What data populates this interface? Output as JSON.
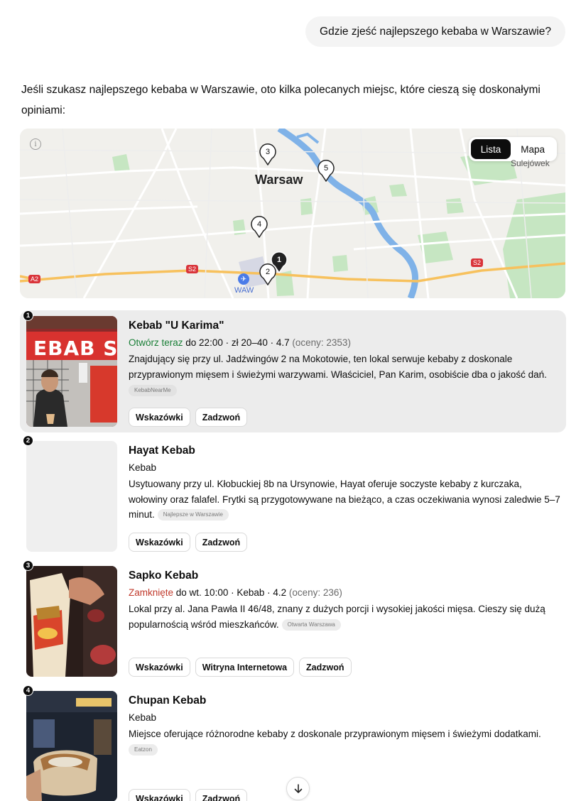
{
  "user_message": "Gdzie zjeść najlepszego kebaba w Warszawie?",
  "intro": "Jeśli szukasz najlepszego kebaba w Warszawie, oto kilka polecanych miejsc, które cieszą się doskonałymi opiniami:",
  "map": {
    "info_glyph": "i",
    "toggle": {
      "list_label": "Lista",
      "map_label": "Mapa",
      "active": "Lista"
    },
    "labels": {
      "city": "Warsaw",
      "town": "Sulejówek",
      "airport": "WAW",
      "road_a2": "A2",
      "road_s2": "S2",
      "road_s2_east": "S2"
    },
    "pins": [
      "1",
      "2",
      "3",
      "4",
      "5"
    ],
    "colors": {
      "background": "#f1f0ec",
      "water": "#7fb2e8",
      "park": "#c6e6c2",
      "road": "#ffffff",
      "highway": "#f7c15d",
      "road_badge": "#d9343a"
    }
  },
  "places": [
    {
      "index": "1",
      "name": "Kebab \"U Karima\"",
      "status": "Otwórz teraz",
      "status_type": "open",
      "details": " do 22:00 · zł 20–40 · 4.7 ",
      "reviews": "(oceny: 2353)",
      "description": "Znajdujący się przy ul. Jadźwingów 2 na Mokotowie, ten lokal serwuje kebaby z doskonale przyprawionym mięsem i świeżymi warzywami. Właściciel, Pan Karim, osobiście dba o jakość dań.",
      "source": "KebabNearMe",
      "buttons": [
        "Wskazówki",
        "Zadzwoń"
      ]
    },
    {
      "index": "2",
      "name": "Hayat Kebab",
      "status": "",
      "status_type": "none",
      "details": "Kebab",
      "reviews": "",
      "description": "Usytuowany przy ul. Kłobuckiej 8b na Ursynowie, Hayat oferuje soczyste kebaby z kurczaka, wołowiny oraz falafel. Frytki są przygotowywane na bieżąco, a czas oczekiwania wynosi zaledwie 5–7 minut.",
      "source": "Najlepsze w Warszawie",
      "buttons": [
        "Wskazówki",
        "Zadzwoń"
      ]
    },
    {
      "index": "3",
      "name": "Sapko Kebab",
      "status": "Zamknięte",
      "status_type": "closed",
      "details": " do wt. 10:00 · Kebab · 4.2 ",
      "reviews": "(oceny: 236)",
      "description": "Lokal przy al. Jana Pawła II 46/48, znany z dużych porcji i wysokiej jakości mięsa. Cieszy się dużą popularnością wśród mieszkańców.",
      "source": "Otwarta Warszawa",
      "buttons": [
        "Wskazówki",
        "Witryna Internetowa",
        "Zadzwoń"
      ]
    },
    {
      "index": "4",
      "name": "Chupan Kebab",
      "status": "",
      "status_type": "none",
      "details": "Kebab",
      "reviews": "",
      "description": "Miejsce oferujące różnorodne kebaby z doskonale przyprawionym mięsem i świeżymi dodatkami.",
      "source": "Eatzon",
      "buttons": [
        "Wskazówki",
        "Zadzwoń"
      ]
    }
  ],
  "photo_1_sign": "EBAB S"
}
